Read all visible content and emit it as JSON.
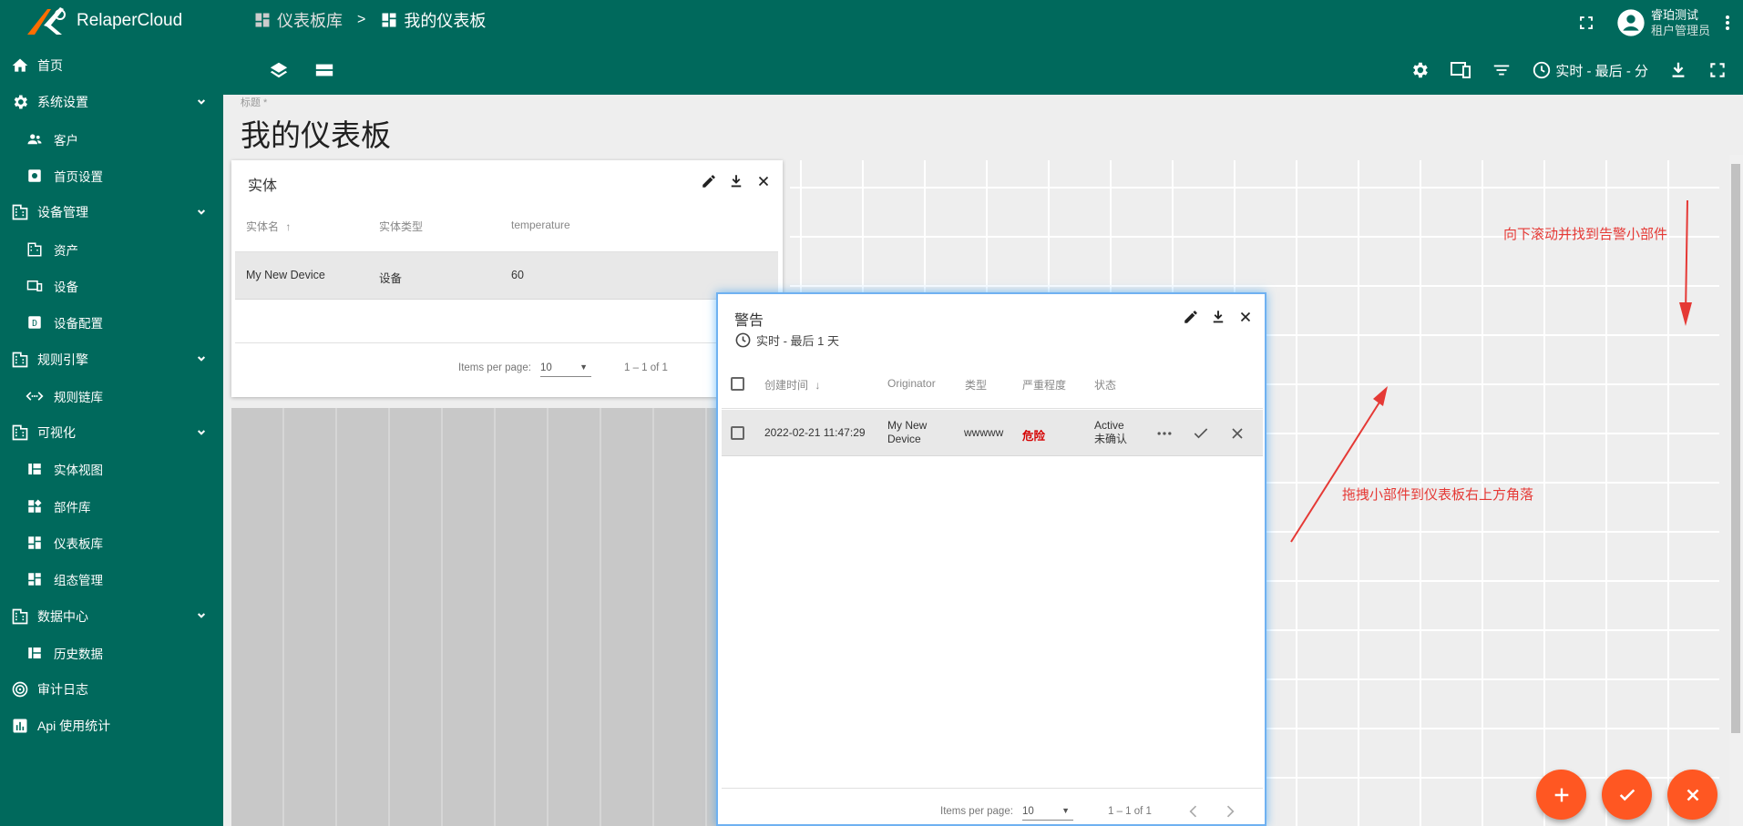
{
  "app": {
    "name": "RelaperCloud"
  },
  "sidebar": {
    "items": [
      {
        "label": "首页",
        "icon": "home-icon"
      },
      {
        "label": "系统设置",
        "icon": "gear-icon"
      },
      {
        "label": "客户",
        "icon": "people-icon"
      },
      {
        "label": "首页设置",
        "icon": "settings-icon"
      },
      {
        "label": "设备管理",
        "icon": "building-icon"
      },
      {
        "label": "资产",
        "icon": "building-icon"
      },
      {
        "label": "设备",
        "icon": "device-icon"
      },
      {
        "label": "设备配置",
        "icon": "profile-icon"
      },
      {
        "label": "规则引擎",
        "icon": "building-icon"
      },
      {
        "label": "规则链库",
        "icon": "chain-icon"
      },
      {
        "label": "可视化",
        "icon": "building-icon"
      },
      {
        "label": "实体视图",
        "icon": "view-icon"
      },
      {
        "label": "部件库",
        "icon": "widgets-icon"
      },
      {
        "label": "仪表板库",
        "icon": "dashboard-icon"
      },
      {
        "label": "组态管理",
        "icon": "dashboard-icon"
      },
      {
        "label": "数据中心",
        "icon": "building-icon"
      },
      {
        "label": "历史数据",
        "icon": "view-icon"
      },
      {
        "label": "审计日志",
        "icon": "track-icon"
      },
      {
        "label": "Api 使用统计",
        "icon": "chart-icon"
      }
    ]
  },
  "header": {
    "breadcrumb": {
      "parent": "仪表板库",
      "separator": ">",
      "current": "我的仪表板"
    },
    "user": {
      "name": "睿珀测试",
      "role": "租户管理员"
    },
    "timewindow": "实时 - 最后 - 分"
  },
  "dashboard": {
    "title_label": "标题 *",
    "title": "我的仪表板"
  },
  "entity_widget": {
    "title": "实体",
    "headers": [
      "实体名",
      "实体类型",
      "temperature"
    ],
    "row": {
      "name": "My New Device",
      "type": "设备",
      "temperature": "60"
    },
    "pagination": {
      "label": "Items per page:",
      "per_page": "10",
      "range": "1 – 1 of 1"
    }
  },
  "alarm_widget": {
    "title": "警告",
    "subtitle": "实时 - 最后 1 天",
    "headers": [
      "创建时间",
      "Originator",
      "类型",
      "严重程度",
      "状态"
    ],
    "row": {
      "time": "2022-02-21 11:47:29",
      "originator": "My New Device",
      "type": "wwwww",
      "severity": "危险",
      "status_line1": "Active",
      "status_line2": "未确认"
    },
    "pagination": {
      "label": "Items per page:",
      "per_page": "10",
      "range": "1 – 1 of 1"
    }
  },
  "annotations": {
    "scroll_hint": "向下滚动并找到告警小部件",
    "drag_hint": "拖拽小部件到仪表板右上方角落"
  },
  "colors": {
    "primary": "#00695c",
    "accent": "#ff5722",
    "danger": "#d50000",
    "annotation": "#e53935"
  }
}
